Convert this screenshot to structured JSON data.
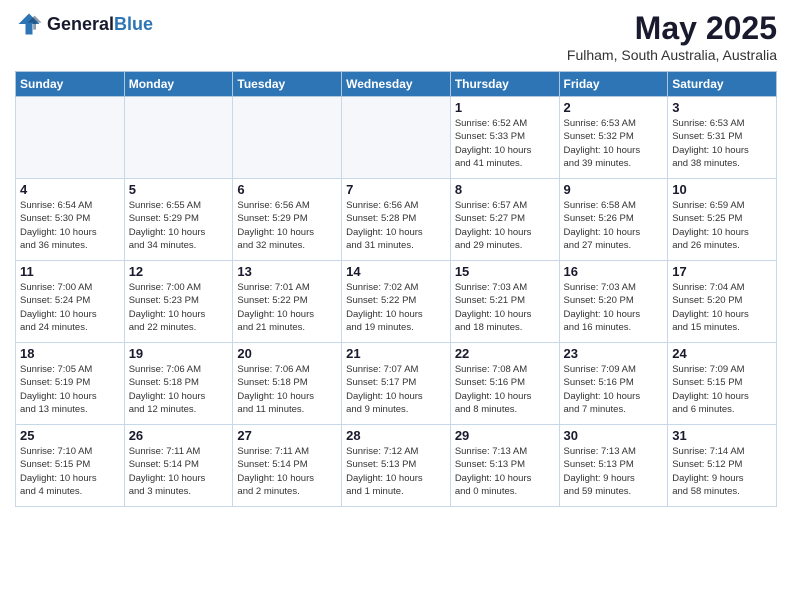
{
  "header": {
    "logo_general": "General",
    "logo_blue": "Blue",
    "month_year": "May 2025",
    "location": "Fulham, South Australia, Australia"
  },
  "weekdays": [
    "Sunday",
    "Monday",
    "Tuesday",
    "Wednesday",
    "Thursday",
    "Friday",
    "Saturday"
  ],
  "weeks": [
    [
      {
        "day": "",
        "info": ""
      },
      {
        "day": "",
        "info": ""
      },
      {
        "day": "",
        "info": ""
      },
      {
        "day": "",
        "info": ""
      },
      {
        "day": "1",
        "info": "Sunrise: 6:52 AM\nSunset: 5:33 PM\nDaylight: 10 hours\nand 41 minutes."
      },
      {
        "day": "2",
        "info": "Sunrise: 6:53 AM\nSunset: 5:32 PM\nDaylight: 10 hours\nand 39 minutes."
      },
      {
        "day": "3",
        "info": "Sunrise: 6:53 AM\nSunset: 5:31 PM\nDaylight: 10 hours\nand 38 minutes."
      }
    ],
    [
      {
        "day": "4",
        "info": "Sunrise: 6:54 AM\nSunset: 5:30 PM\nDaylight: 10 hours\nand 36 minutes."
      },
      {
        "day": "5",
        "info": "Sunrise: 6:55 AM\nSunset: 5:29 PM\nDaylight: 10 hours\nand 34 minutes."
      },
      {
        "day": "6",
        "info": "Sunrise: 6:56 AM\nSunset: 5:29 PM\nDaylight: 10 hours\nand 32 minutes."
      },
      {
        "day": "7",
        "info": "Sunrise: 6:56 AM\nSunset: 5:28 PM\nDaylight: 10 hours\nand 31 minutes."
      },
      {
        "day": "8",
        "info": "Sunrise: 6:57 AM\nSunset: 5:27 PM\nDaylight: 10 hours\nand 29 minutes."
      },
      {
        "day": "9",
        "info": "Sunrise: 6:58 AM\nSunset: 5:26 PM\nDaylight: 10 hours\nand 27 minutes."
      },
      {
        "day": "10",
        "info": "Sunrise: 6:59 AM\nSunset: 5:25 PM\nDaylight: 10 hours\nand 26 minutes."
      }
    ],
    [
      {
        "day": "11",
        "info": "Sunrise: 7:00 AM\nSunset: 5:24 PM\nDaylight: 10 hours\nand 24 minutes."
      },
      {
        "day": "12",
        "info": "Sunrise: 7:00 AM\nSunset: 5:23 PM\nDaylight: 10 hours\nand 22 minutes."
      },
      {
        "day": "13",
        "info": "Sunrise: 7:01 AM\nSunset: 5:22 PM\nDaylight: 10 hours\nand 21 minutes."
      },
      {
        "day": "14",
        "info": "Sunrise: 7:02 AM\nSunset: 5:22 PM\nDaylight: 10 hours\nand 19 minutes."
      },
      {
        "day": "15",
        "info": "Sunrise: 7:03 AM\nSunset: 5:21 PM\nDaylight: 10 hours\nand 18 minutes."
      },
      {
        "day": "16",
        "info": "Sunrise: 7:03 AM\nSunset: 5:20 PM\nDaylight: 10 hours\nand 16 minutes."
      },
      {
        "day": "17",
        "info": "Sunrise: 7:04 AM\nSunset: 5:20 PM\nDaylight: 10 hours\nand 15 minutes."
      }
    ],
    [
      {
        "day": "18",
        "info": "Sunrise: 7:05 AM\nSunset: 5:19 PM\nDaylight: 10 hours\nand 13 minutes."
      },
      {
        "day": "19",
        "info": "Sunrise: 7:06 AM\nSunset: 5:18 PM\nDaylight: 10 hours\nand 12 minutes."
      },
      {
        "day": "20",
        "info": "Sunrise: 7:06 AM\nSunset: 5:18 PM\nDaylight: 10 hours\nand 11 minutes."
      },
      {
        "day": "21",
        "info": "Sunrise: 7:07 AM\nSunset: 5:17 PM\nDaylight: 10 hours\nand 9 minutes."
      },
      {
        "day": "22",
        "info": "Sunrise: 7:08 AM\nSunset: 5:16 PM\nDaylight: 10 hours\nand 8 minutes."
      },
      {
        "day": "23",
        "info": "Sunrise: 7:09 AM\nSunset: 5:16 PM\nDaylight: 10 hours\nand 7 minutes."
      },
      {
        "day": "24",
        "info": "Sunrise: 7:09 AM\nSunset: 5:15 PM\nDaylight: 10 hours\nand 6 minutes."
      }
    ],
    [
      {
        "day": "25",
        "info": "Sunrise: 7:10 AM\nSunset: 5:15 PM\nDaylight: 10 hours\nand 4 minutes."
      },
      {
        "day": "26",
        "info": "Sunrise: 7:11 AM\nSunset: 5:14 PM\nDaylight: 10 hours\nand 3 minutes."
      },
      {
        "day": "27",
        "info": "Sunrise: 7:11 AM\nSunset: 5:14 PM\nDaylight: 10 hours\nand 2 minutes."
      },
      {
        "day": "28",
        "info": "Sunrise: 7:12 AM\nSunset: 5:13 PM\nDaylight: 10 hours\nand 1 minute."
      },
      {
        "day": "29",
        "info": "Sunrise: 7:13 AM\nSunset: 5:13 PM\nDaylight: 10 hours\nand 0 minutes."
      },
      {
        "day": "30",
        "info": "Sunrise: 7:13 AM\nSunset: 5:13 PM\nDaylight: 9 hours\nand 59 minutes."
      },
      {
        "day": "31",
        "info": "Sunrise: 7:14 AM\nSunset: 5:12 PM\nDaylight: 9 hours\nand 58 minutes."
      }
    ]
  ]
}
